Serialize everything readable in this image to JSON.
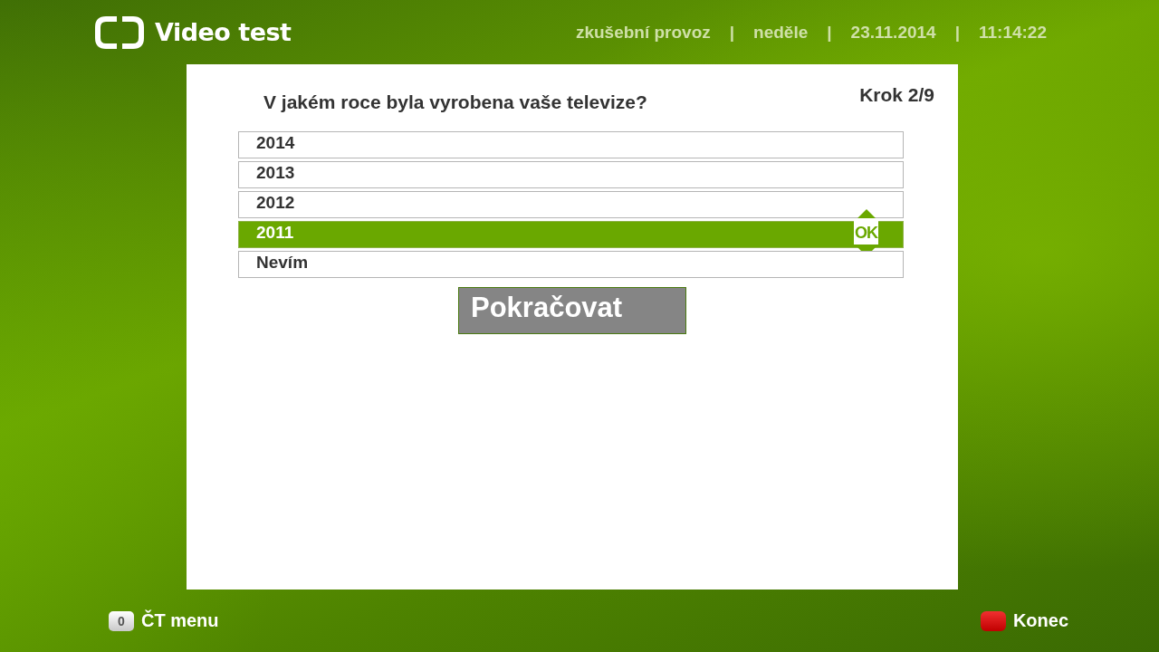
{
  "header": {
    "logo_text": "Video test",
    "status": [
      "zkušební provoz",
      "|",
      "neděle",
      "|",
      "23.11.2014",
      "|",
      "11:14:22"
    ]
  },
  "question": {
    "text": "V jakém roce byla vyrobena vaše televize?",
    "step": "Krok 2/9"
  },
  "options": [
    {
      "label": "2014",
      "selected": false
    },
    {
      "label": "2013",
      "selected": false
    },
    {
      "label": "2012",
      "selected": false
    },
    {
      "label": "2011",
      "selected": true
    },
    {
      "label": "Nevím",
      "selected": false
    }
  ],
  "ok_hint": "OK",
  "continue_button": "Pokračovat",
  "footer": {
    "left": {
      "key": "0",
      "label": "ČT menu"
    },
    "right": {
      "label": "Konec"
    }
  }
}
